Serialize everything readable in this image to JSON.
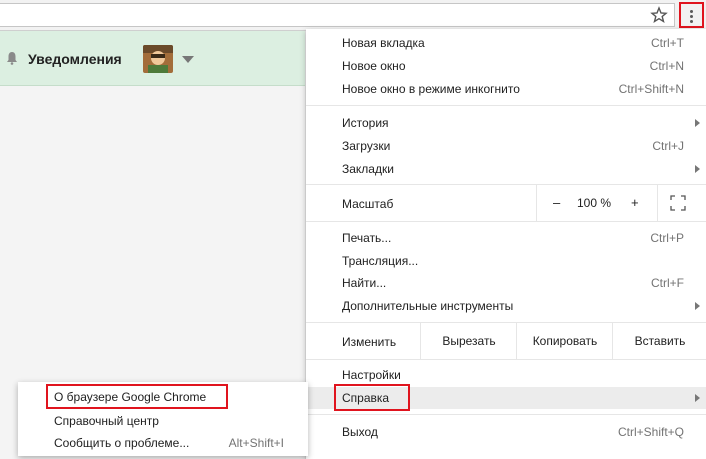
{
  "colors": {
    "highlight": "#e0141e",
    "header_bg": "#dcefe1",
    "menu_bg": "#ffffff"
  },
  "toolbar": {
    "star_icon": "star-icon",
    "menu_icon": "three-dots-icon"
  },
  "header": {
    "title": "Уведомления",
    "bell_icon": "bell-icon"
  },
  "menu": {
    "items": [
      {
        "label": "Новая вкладка",
        "shortcut": "Ctrl+T"
      },
      {
        "label": "Новое окно",
        "shortcut": "Ctrl+N"
      },
      {
        "label": "Новое окно в режиме инкогнито",
        "shortcut": "Ctrl+Shift+N"
      },
      {
        "label": "История",
        "shortcut": ""
      },
      {
        "label": "Загрузки",
        "shortcut": "Ctrl+J"
      },
      {
        "label": "Закладки",
        "shortcut": ""
      },
      {
        "label": "Печать...",
        "shortcut": "Ctrl+P"
      },
      {
        "label": "Трансляция...",
        "shortcut": ""
      },
      {
        "label": "Найти...",
        "shortcut": "Ctrl+F"
      },
      {
        "label": "Дополнительные инструменты",
        "shortcut": ""
      },
      {
        "label": "Настройки",
        "shortcut": ""
      },
      {
        "label": "Справка",
        "shortcut": ""
      },
      {
        "label": "Выход",
        "shortcut": "Ctrl+Shift+Q"
      }
    ],
    "zoom": {
      "label": "Масштаб",
      "minus": "–",
      "value": "100 %",
      "plus": "+"
    },
    "edit": {
      "label": "Изменить",
      "cut": "Вырезать",
      "copy": "Копировать",
      "paste": "Вставить"
    }
  },
  "submenu": {
    "items": [
      {
        "label": "О браузере Google Chrome",
        "shortcut": ""
      },
      {
        "label": "Справочный центр",
        "shortcut": ""
      },
      {
        "label": "Сообщить о проблеме...",
        "shortcut": "Alt+Shift+I"
      }
    ]
  }
}
